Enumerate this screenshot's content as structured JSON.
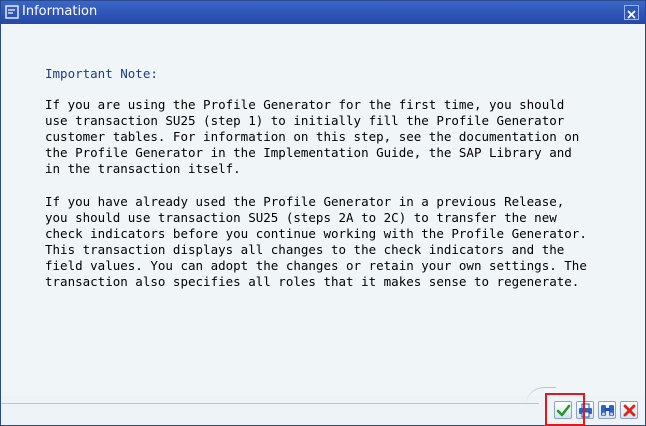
{
  "window": {
    "title": "Information"
  },
  "content": {
    "heading": "Important Note:",
    "paragraph1": [
      "If you are using the Profile Generator for the first time, you should",
      "use transaction SU25 (step 1) to initially fill the Profile Generator",
      "customer tables. For information on this step, see the documentation on",
      "the Profile Generator in the Implementation Guide, the SAP Library and",
      "in the transaction itself."
    ],
    "paragraph2": [
      "If you have already used the Profile Generator in a previous Release,",
      "you should use transaction SU25 (steps 2A to 2C) to transfer the new",
      "check indicators before you continue working with the Profile Generator.",
      "This transaction displays all changes to the check indicators and the",
      "field values. You can adopt the changes or retain your own settings. The",
      "transaction also specifies all roles that it makes sense to regenerate."
    ]
  },
  "footer_buttons": [
    {
      "icon": "checkmark-icon",
      "action": "continue"
    },
    {
      "icon": "print-icon",
      "action": "print"
    },
    {
      "icon": "binoculars-icon",
      "action": "find"
    },
    {
      "icon": "cancel-x-icon",
      "action": "cancel"
    }
  ],
  "colors": {
    "titlebar": "#2d57b8",
    "heading": "#1c3d8a",
    "highlight": "#e3181f"
  }
}
